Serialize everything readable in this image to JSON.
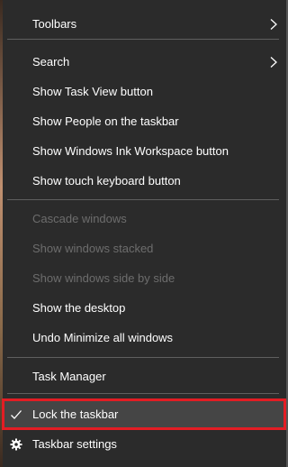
{
  "menu": {
    "items": [
      {
        "label": "Toolbars",
        "submenu": true,
        "enabled": true
      },
      {
        "label": "Search",
        "submenu": true,
        "enabled": true
      },
      {
        "label": "Show Task View button",
        "enabled": true
      },
      {
        "label": "Show People on the taskbar",
        "enabled": true
      },
      {
        "label": "Show Windows Ink Workspace button",
        "enabled": true
      },
      {
        "label": "Show touch keyboard button",
        "enabled": true
      },
      {
        "label": "Cascade windows",
        "enabled": false
      },
      {
        "label": "Show windows stacked",
        "enabled": false
      },
      {
        "label": "Show windows side by side",
        "enabled": false
      },
      {
        "label": "Show the desktop",
        "enabled": true
      },
      {
        "label": "Undo Minimize all windows",
        "enabled": true
      },
      {
        "label": "Task Manager",
        "enabled": true
      },
      {
        "label": "Lock the taskbar",
        "checked": true,
        "highlighted": true,
        "enabled": true
      },
      {
        "label": "Taskbar settings",
        "icon": "gear-icon",
        "enabled": true
      }
    ]
  },
  "colors": {
    "menu_background": "#2b2b2b",
    "text": "#ffffff",
    "disabled_text": "#6d6d6d",
    "separator": "#5f5f5f",
    "hover_background": "#454545",
    "highlight_border": "#e31d24"
  }
}
